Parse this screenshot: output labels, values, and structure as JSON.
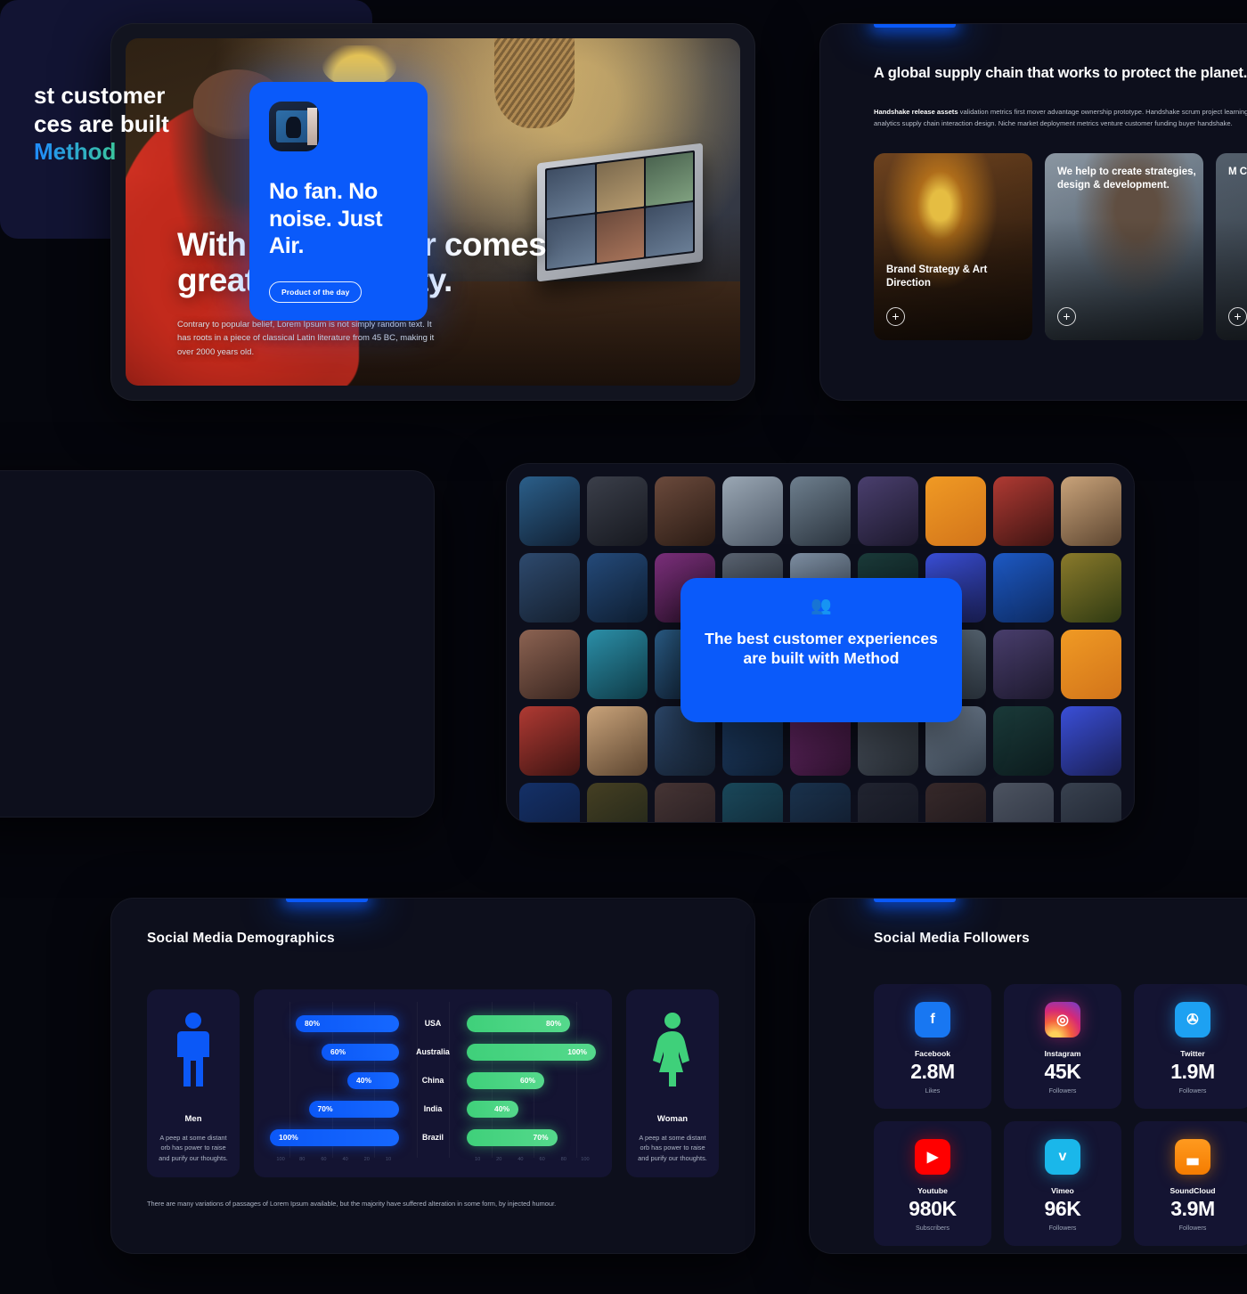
{
  "hero": {
    "title": "With great power comes great productivity.",
    "body": "Contrary to popular belief, Lorem Ipsum is not simply random text. It has roots in a piece of classical Latin literature from 45 BC, making it over 2000 years old."
  },
  "supply": {
    "title": "A global supply chain that works to protect the planet.",
    "body_bold": "Handshake release assets",
    "body": " validation metrics first mover advantage ownership prototype. Handshake scrum project learning pivot analytics supply chain interaction design. Niche market deployment metrics venture customer funding buyer handshake.",
    "cards": [
      {
        "caption": "Brand Strategy & Art Direction",
        "plus": "+"
      },
      {
        "caption": "We help to create strategies, design & development.",
        "plus": "+"
      },
      {
        "caption": "M C C",
        "plus": "+"
      }
    ]
  },
  "purple_card": {
    "line1": "st customer",
    "line2": "ces are built",
    "line3": "Method"
  },
  "air": {
    "title": "No fan. No noise. Just Air.",
    "button": "Product of the day"
  },
  "grid_overlay": {
    "icon": "people-icon",
    "text": "The best customer experiences are built with Method"
  },
  "demographics": {
    "title": "Social Media Demographics",
    "men": {
      "label": "Men",
      "desc": "A peep at some distant orb has power to raise and purify our thoughts."
    },
    "woman": {
      "label": "Woman",
      "desc": "A peep at some distant orb has power to raise and purify our thoughts."
    },
    "footer": "There are many variations of passages of Lorem Ipsum available, but the majority have suffered alteration in some form, by injected humour.",
    "left_ticks": [
      "100",
      "80",
      "60",
      "40",
      "20",
      "10"
    ],
    "right_ticks": [
      "10",
      "20",
      "40",
      "60",
      "80",
      "100"
    ]
  },
  "chart_data": {
    "type": "bar",
    "title": "Social Media Demographics",
    "orientation": "horizontal-diverging",
    "categories": [
      "USA",
      "Australia",
      "China",
      "India",
      "Brazil"
    ],
    "series": [
      {
        "name": "Men",
        "color": "#0b58f7",
        "side": "left",
        "values": [
          80,
          60,
          40,
          70,
          100
        ],
        "labels": [
          "80%",
          "60%",
          "40%",
          "70%",
          "100%"
        ]
      },
      {
        "name": "Woman",
        "color": "#3fd07a",
        "side": "right",
        "values": [
          80,
          100,
          60,
          40,
          70
        ],
        "labels": [
          "80%",
          "100%",
          "60%",
          "40%",
          "70%"
        ]
      }
    ],
    "xlabel": "",
    "ylabel": "",
    "xlim": [
      0,
      100
    ],
    "grid": true,
    "legend": "none"
  },
  "followers": {
    "title": "Social Media Followers",
    "cards": [
      {
        "icon": "facebook-icon",
        "glyph": "f",
        "name": "Facebook",
        "value": "2.8M",
        "sub": "Likes",
        "color": "#1877f2"
      },
      {
        "icon": "instagram-icon",
        "glyph": "◎",
        "name": "Instagram",
        "value": "45K",
        "sub": "Followers",
        "color": "#d62976"
      },
      {
        "icon": "twitter-icon",
        "glyph": "✇",
        "name": "Twitter",
        "value": "1.9M",
        "sub": "Followers",
        "color": "#1da1f2"
      },
      {
        "icon": "youtube-icon",
        "glyph": "▶",
        "name": "Youtube",
        "value": "980K",
        "sub": "Subscribers",
        "color": "#ff0000"
      },
      {
        "icon": "vimeo-icon",
        "glyph": "v",
        "name": "Vimeo",
        "value": "96K",
        "sub": "Followers",
        "color": "#1ab7ea"
      },
      {
        "icon": "soundcloud-icon",
        "glyph": "▃",
        "name": "SoundCloud",
        "value": "3.9M",
        "sub": "Followers",
        "color": "#ff8800"
      }
    ]
  },
  "colors": {
    "background": "#05060d",
    "panel": "#0d0f1c",
    "card": "#141432",
    "accent_blue": "#0a5afa",
    "accent_green": "#3fd07a",
    "purple_card": "#121433"
  }
}
